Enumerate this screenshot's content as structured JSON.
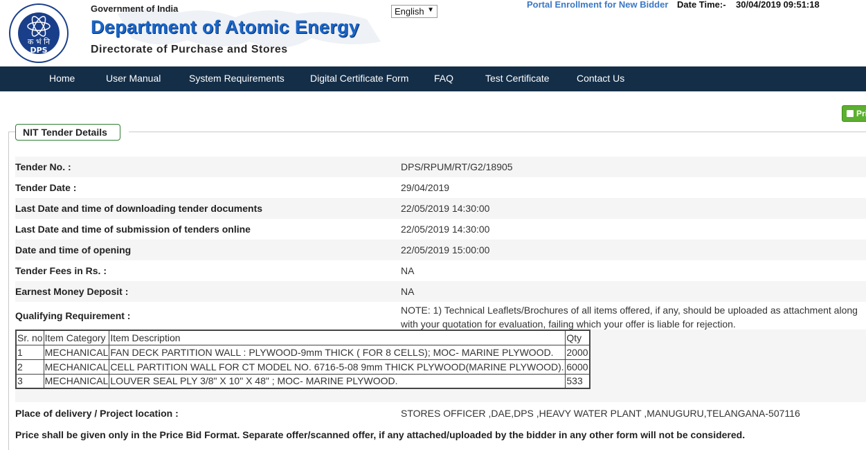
{
  "header": {
    "government": "Government of India",
    "department": "Department of Atomic Energy",
    "directorate": "Directorate of Purchase and Stores",
    "logo_text": "DPS",
    "logo_hindi": "क भं नि",
    "language": "English",
    "portal_link": "Portal Enrollment for New Bidder",
    "date_time_label": "Date Time:-",
    "date_time_value": "30/04/2019 09:51:18"
  },
  "nav": {
    "items": [
      "Home",
      "User Manual",
      "System Requirements",
      "Digital Certificate Form",
      "FAQ",
      "Test Certificate",
      "Contact Us"
    ]
  },
  "print_label": "Pri",
  "section_title": "NIT Tender Details",
  "details": [
    {
      "label": "Tender No. :",
      "value": "DPS/RPUM/RT/G2/18905"
    },
    {
      "label": "Tender Date :",
      "value": "29/04/2019"
    },
    {
      "label": "Last Date and time of downloading tender documents",
      "value": "22/05/2019 14:30:00"
    },
    {
      "label": "Last Date and time of submission of tenders online",
      "value": "22/05/2019 14:30:00"
    },
    {
      "label": "Date and time of opening",
      "value": "22/05/2019 15:00:00"
    },
    {
      "label": "Tender Fees in Rs. :",
      "value": "NA"
    },
    {
      "label": "Earnest Money Deposit :",
      "value": "NA"
    }
  ],
  "qualifying": {
    "label": "Qualifying Requirement :",
    "value": "NOTE: 1) Technical Leaflets/Brochures of all items offered, if any, should be uploaded as attachment along with your quotation for evaluation, failing which your offer is liable for rejection."
  },
  "items_table": {
    "headers": [
      "Sr. no",
      "Item Category",
      "Item Description",
      "Qty"
    ],
    "rows": [
      [
        "1",
        "MECHANICAL",
        "FAN DECK PARTITION WALL : PLYWOOD-9mm THICK ( FOR 8 CELLS); MOC- MARINE PLYWOOD.",
        "2000"
      ],
      [
        "2",
        "MECHANICAL",
        "CELL PARTITION WALL FOR CT MODEL NO. 6716-5-08 9mm THICK PLYWOOD(MARINE PLYWOOD).",
        "6000"
      ],
      [
        "3",
        "MECHANICAL",
        "LOUVER SEAL PLY 3/8\" X 10\" X 48\" ; MOC- MARINE PLYWOOD.",
        "533"
      ]
    ]
  },
  "delivery": {
    "label": "Place of delivery / Project location :",
    "value": "STORES OFFICER ,DAE,DPS ,HEAVY WATER PLANT ,MANUGURU,TELANGANA-507116"
  },
  "price_note": "Price shall be given only in the Price Bid Format. Separate offer/scanned offer, if any attached/uploaded by the bidder in any other form will not be considered.",
  "colors": {
    "nav_bg": "#142e48",
    "dept_blue": "#1a66c9",
    "print_green": "#5cb030",
    "row_shade": "#f5f5f5"
  }
}
